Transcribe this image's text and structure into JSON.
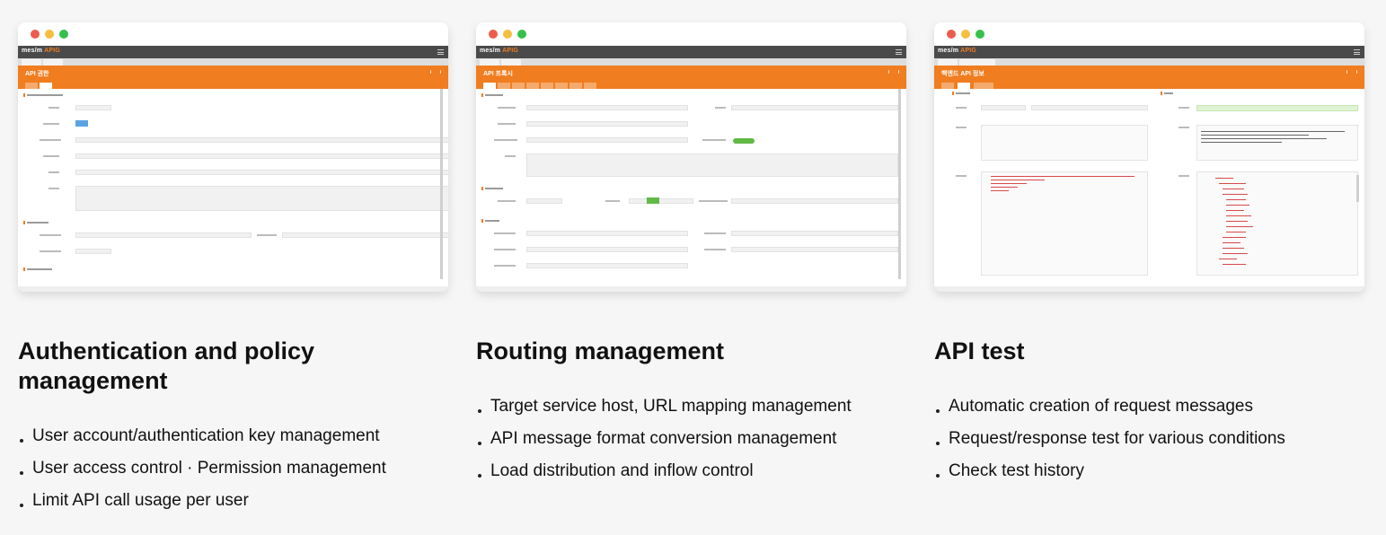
{
  "accent_color": "#f07d1f",
  "cards": [
    {
      "screenshot": {
        "app_logo": "mes/m",
        "app_logo_suffix": "APIG",
        "page_title": "API 권한"
      },
      "heading": "Authentication and policy management",
      "bullets": [
        "User account/authentication key management",
        "User access control · Permission management",
        "Limit API call usage per user"
      ]
    },
    {
      "screenshot": {
        "app_logo": "mes/m",
        "app_logo_suffix": "APIG",
        "page_title": "API 프록시"
      },
      "heading": "Routing management",
      "bullets": [
        "Target service host, URL mapping management",
        "API message format conversion management",
        "Load distribution and inflow control"
      ]
    },
    {
      "screenshot": {
        "app_logo": "mes/m",
        "app_logo_suffix": "APIG",
        "page_title": "백엔드 API 정보"
      },
      "heading": "API test",
      "bullets": [
        "Automatic creation of request messages",
        "Request/response test for various conditions",
        "Check test history"
      ]
    }
  ]
}
